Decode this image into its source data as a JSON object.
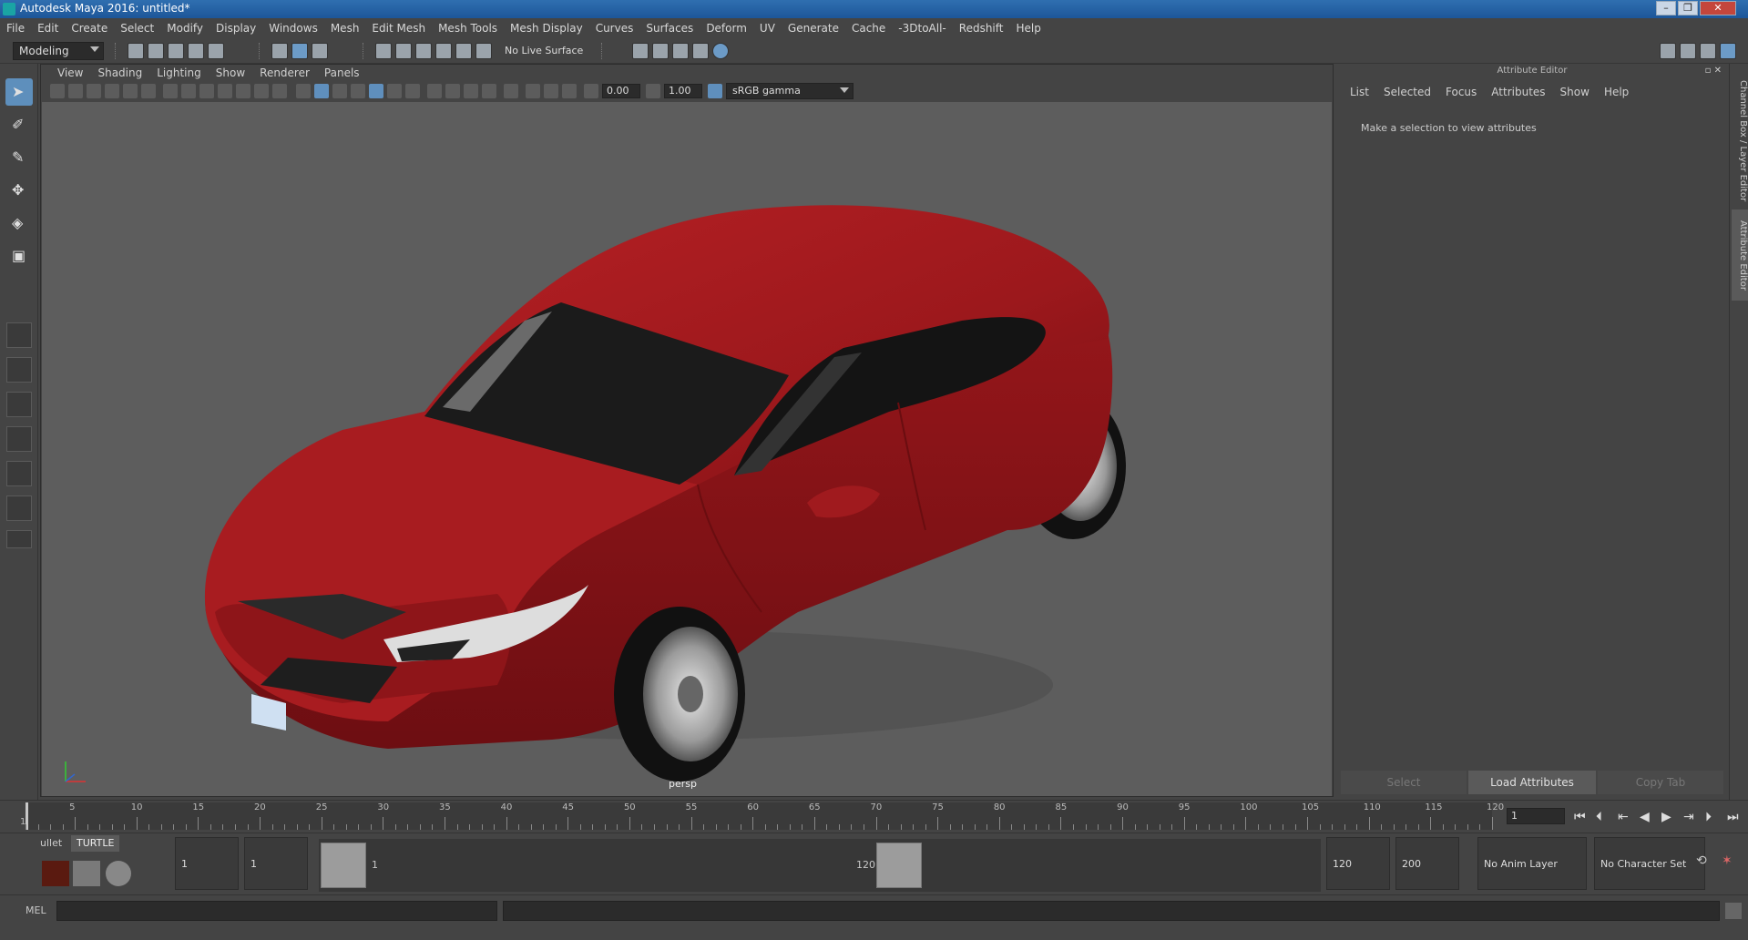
{
  "window": {
    "title": "Autodesk Maya 2016: untitled*",
    "controls": [
      "–",
      "❐",
      "✕"
    ]
  },
  "menubar": [
    "File",
    "Edit",
    "Create",
    "Select",
    "Modify",
    "Display",
    "Windows",
    "Mesh",
    "Edit Mesh",
    "Mesh Tools",
    "Mesh Display",
    "Curves",
    "Surfaces",
    "Deform",
    "UV",
    "Generate",
    "Cache",
    "-3DtoAll-",
    "Redshift",
    "Help"
  ],
  "statusline": {
    "menuset": "Modeling",
    "live_surface": "No Live Surface"
  },
  "viewport": {
    "menu": [
      "View",
      "Shading",
      "Lighting",
      "Show",
      "Renderer",
      "Panels"
    ],
    "exposure": "0.00",
    "gamma": "1.00",
    "colorspace": "sRGB gamma",
    "camera": "persp"
  },
  "attribute_editor": {
    "title": "Attribute Editor",
    "menu": [
      "List",
      "Selected",
      "Focus",
      "Attributes",
      "Show",
      "Help"
    ],
    "message": "Make a selection to view attributes",
    "buttons": {
      "select": "Select",
      "load": "Load Attributes",
      "copy": "Copy Tab"
    }
  },
  "side_tabs": {
    "channel_box": "Channel Box / Layer Editor",
    "attribute_editor": "Attribute Editor"
  },
  "timeline": {
    "ticks": [
      "5",
      "10",
      "15",
      "20",
      "25",
      "30",
      "35",
      "40",
      "45",
      "50",
      "55",
      "60",
      "65",
      "70",
      "75",
      "80",
      "85",
      "90",
      "95",
      "100",
      "105",
      "110",
      "115",
      "120"
    ],
    "first_tick": "1",
    "current_frame": "1"
  },
  "range": {
    "start": "1",
    "playback_start": "1",
    "handle_start": "1",
    "handle_end": "120",
    "playback_end": "120",
    "end": "200",
    "anim_layer": "No Anim Layer",
    "character_set": "No Character Set"
  },
  "shelf": {
    "tabs": [
      "ullet",
      "TURTLE"
    ]
  },
  "cmdline": {
    "label": "MEL"
  },
  "colors": {
    "accent": "#5e8fbc",
    "car": "#a01a1e",
    "viewport_bg": "#5d5d5d"
  }
}
